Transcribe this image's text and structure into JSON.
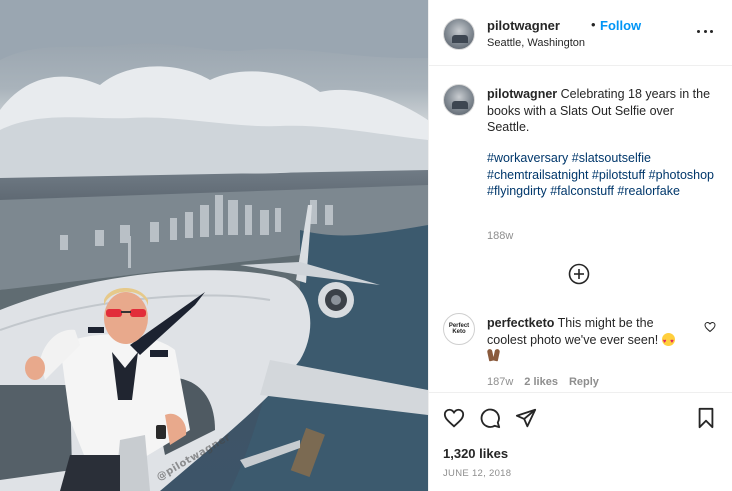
{
  "post": {
    "image_description_icon": "selfie-photo",
    "watermark": "@pilotwagner"
  },
  "header": {
    "username": "pilotwagner",
    "separator": "•",
    "follow_label": "Follow",
    "location": "Seattle, Washington",
    "more_icon": "more-horizontal-icon"
  },
  "caption": {
    "username": "pilotwagner",
    "text": "Celebrating 18 years in the books with a Slats Out Selfie over Seattle.",
    "hashtags": "#workaversary #slatsoutselfie #chemtrailsatnight #pilotstuff #photoshop #flyingdirty #falconstuff #realorfake",
    "age": "188w"
  },
  "load_more_icon": "plus-circle-icon",
  "comment": {
    "avatar_text": "Perfect Keto",
    "username": "perfectketo",
    "text": "This might be the coolest photo we've ever seen!",
    "age": "187w",
    "likes": "2 likes",
    "reply_label": "Reply"
  },
  "actions": {
    "like_icon": "heart-icon",
    "comment_icon": "comment-icon",
    "share_icon": "send-icon",
    "save_icon": "bookmark-icon"
  },
  "likes_count": "1,320 likes",
  "date": "JUNE 12, 2018",
  "colors": {
    "link_blue": "#0095f6",
    "hashtag_blue": "#00376b",
    "muted": "#8e8e8e",
    "text": "#262626"
  }
}
